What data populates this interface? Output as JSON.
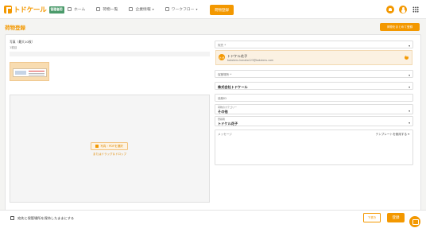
{
  "header": {
    "logo_text": "トドケール",
    "logo_badge": "管理者用",
    "nav": [
      {
        "label": "ホーム",
        "icon": "home-icon"
      },
      {
        "label": "荷物一覧",
        "icon": "list-icon"
      },
      {
        "label": "企業情報",
        "icon": "building-icon",
        "dropdown": true
      },
      {
        "label": "ワークフロー",
        "icon": "workflow-icon",
        "dropdown": true
      }
    ],
    "register_button": "荷物登録"
  },
  "page": {
    "title": "荷物登録",
    "bulk_button": "荷物をまとめて登録"
  },
  "photos": {
    "label": "写真（最大10枚）",
    "count": "1枚目",
    "select_button": "写真・PDFを選択",
    "drop_hint": "またはドラッグ＆ドロップ"
  },
  "form": {
    "recipient_label": "宛先 *",
    "recipient": {
      "initial": "トド",
      "name": "トドケル花子",
      "email": "todokeru.hanako123@todokeru.com"
    },
    "storage_label": "保管場所 *",
    "company_value": "株式会社トドケール",
    "tracking_placeholder": "追跡ID",
    "category_label": "荷物のカテゴリー",
    "category_value": "その他",
    "registrant_label": "登録者",
    "registrant_value": "トドケル花子",
    "message_placeholder": "メッセージ",
    "template_button": "テンプレートを使用する"
  },
  "footer": {
    "keep_checkbox_label": "宛先と保管場所を保持したままにする",
    "draft_button": "下書き",
    "submit_button": "登録"
  },
  "colors": {
    "accent": "#f39800",
    "badge": "#4a9a6a"
  }
}
